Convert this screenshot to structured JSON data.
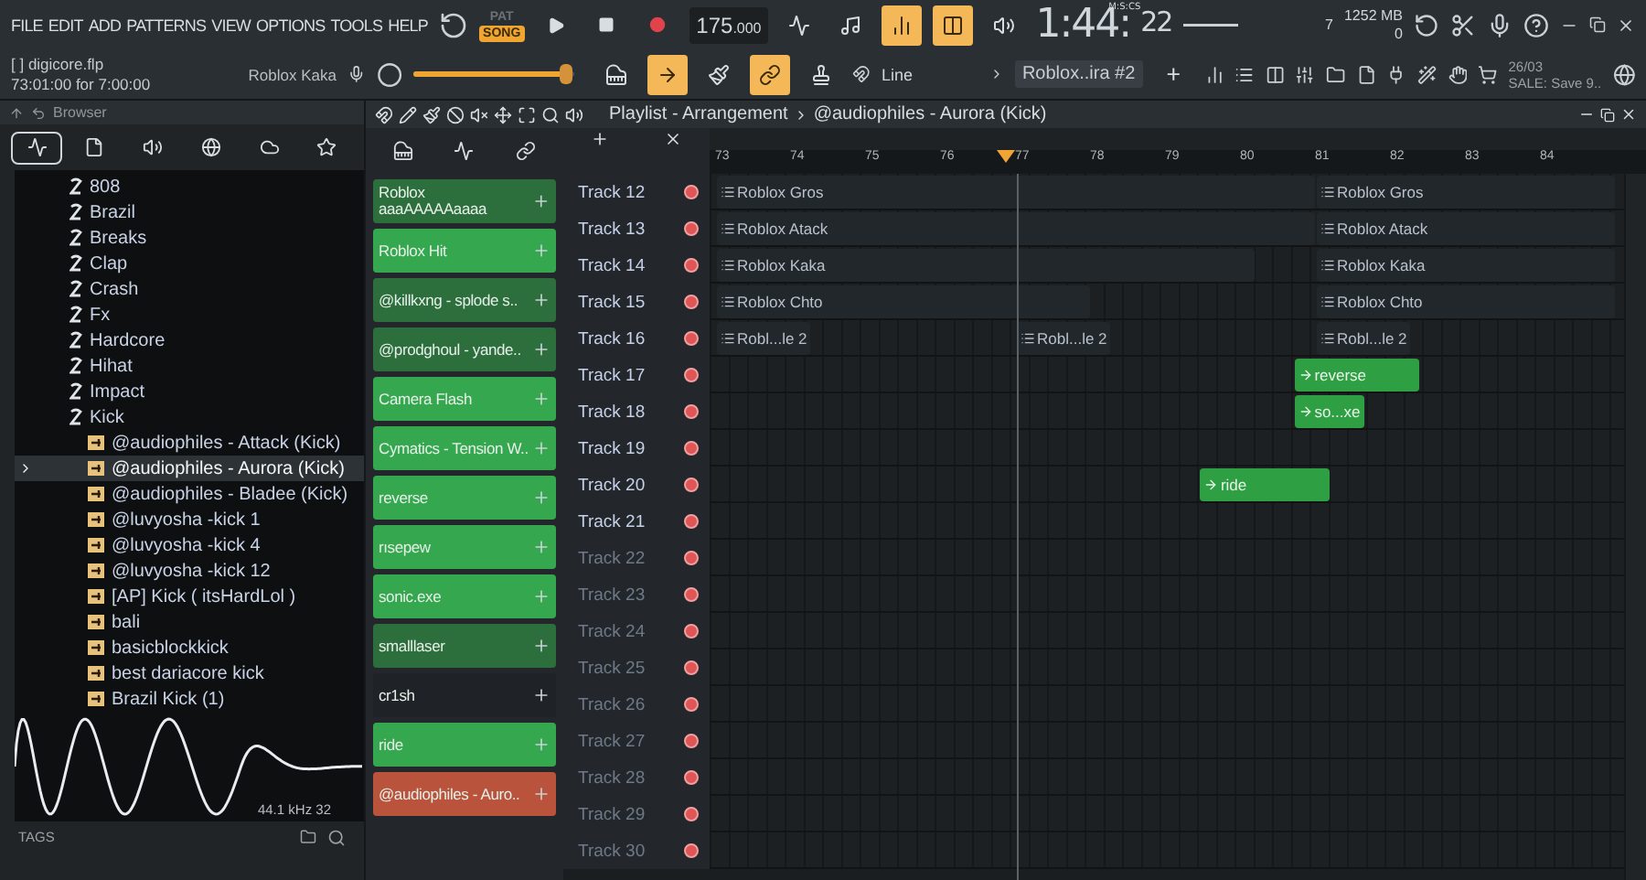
{
  "menu": [
    "FILE",
    "EDIT",
    "ADD",
    "PATTERNS",
    "VIEW",
    "OPTIONS",
    "TOOLS",
    "HELP"
  ],
  "transport": {
    "modes": [
      {
        "label": "PAT",
        "selected": false
      },
      {
        "label": "SONG",
        "selected": true
      }
    ],
    "tempo": "175",
    "tempo_decimals": ".000",
    "time": "1:44:",
    "time_cs": "22",
    "time_format": "M:S:CS"
  },
  "toolbar_toggles": [
    {
      "on": false
    },
    {
      "on": false
    },
    {
      "on": true
    },
    {
      "on": true
    },
    {
      "on": false
    }
  ],
  "tool_toggles": [
    {
      "on": false
    },
    {
      "on": true
    },
    {
      "on": false
    },
    {
      "on": true
    },
    {
      "on": false
    }
  ],
  "monitor": {
    "voices": "7",
    "memory": "1252 MB",
    "cpu": "0"
  },
  "project": {
    "file": "[ ] digicore.flp",
    "position": "73:01:00 for 7:00:00",
    "hint": "Roblox Kaka",
    "master": {
      "level": 0.95
    }
  },
  "snap": "Line",
  "pattern": "Roblox..ira #2",
  "pattern_add": "+",
  "news": {
    "date": "26/03",
    "text": "SALE: Save 9.."
  },
  "browser": {
    "title": "Browser",
    "tabs": [
      {
        "selected": true
      },
      {
        "selected": false
      },
      {
        "selected": false
      },
      {
        "selected": false
      },
      {
        "selected": false
      },
      {
        "selected": false
      }
    ],
    "tree": [
      {
        "name": "808",
        "kind": "folder",
        "selected": false
      },
      {
        "name": "Brazil",
        "kind": "folder",
        "selected": false
      },
      {
        "name": "Breaks",
        "kind": "folder",
        "selected": false
      },
      {
        "name": "Clap",
        "kind": "folder",
        "selected": false
      },
      {
        "name": "Crash",
        "kind": "folder",
        "selected": false
      },
      {
        "name": "Fx",
        "kind": "folder",
        "selected": false
      },
      {
        "name": "Hardcore",
        "kind": "folder",
        "selected": false
      },
      {
        "name": "Hihat",
        "kind": "folder",
        "selected": false
      },
      {
        "name": "Impact",
        "kind": "folder",
        "selected": false
      },
      {
        "name": "Kick",
        "kind": "folder",
        "selected": false,
        "children": [
          {
            "name": "@audiophiles - Attack (Kick)",
            "kind": "file",
            "selected": false
          },
          {
            "name": "@audiophiles - Aurora (Kick)",
            "kind": "file",
            "selected": true
          },
          {
            "name": "@audiophiles - Bladee (Kick)",
            "kind": "file",
            "selected": false
          },
          {
            "name": "@luvyosha -kick 1",
            "kind": "file",
            "selected": false
          },
          {
            "name": "@luvyosha -kick 4",
            "kind": "file",
            "selected": false
          },
          {
            "name": "@luvyosha -kick 12",
            "kind": "file",
            "selected": false
          },
          {
            "name": "[AP] Kick ( itsHardLol )",
            "kind": "file",
            "selected": false
          },
          {
            "name": "bali",
            "kind": "file",
            "selected": false
          },
          {
            "name": "basicblockkick",
            "kind": "file",
            "selected": false
          },
          {
            "name": "best dariacore kick",
            "kind": "file",
            "selected": false
          },
          {
            "name": "Brazil Kick (1)",
            "kind": "file",
            "selected": false
          }
        ]
      }
    ],
    "preview_info": "44.1 kHz 32",
    "tags": "TAGS"
  },
  "playlist": {
    "title": "Playlist - Arrangement",
    "pattern": "@audiophiles - Aurora (Kick)",
    "ruler": [
      "73",
      "74",
      "75",
      "76",
      "77",
      "78",
      "79",
      "80",
      "81",
      "82",
      "83",
      "84"
    ],
    "tracks": [
      {
        "name": "Track 12",
        "active": true,
        "clips": [
          {
            "label": "Roblox Gros",
            "kind": "pattern"
          },
          {
            "label": "Roblox Gros",
            "kind": "pattern"
          }
        ]
      },
      {
        "name": "Track 13",
        "active": true,
        "clips": [
          {
            "label": "Roblox Atack",
            "kind": "pattern"
          },
          {
            "label": "Roblox Atack",
            "kind": "pattern"
          }
        ]
      },
      {
        "name": "Track 14",
        "active": true,
        "clips": [
          {
            "label": "Roblox Kaka",
            "kind": "pattern"
          },
          {
            "label": "Roblox Kaka",
            "kind": "pattern"
          }
        ]
      },
      {
        "name": "Track 15",
        "active": true,
        "clips": [
          {
            "label": "Roblox Chto",
            "kind": "pattern"
          },
          {
            "label": "Roblox Chto",
            "kind": "pattern"
          }
        ]
      },
      {
        "name": "Track 16",
        "active": true,
        "clips": [
          {
            "label": "Robl...le 2",
            "kind": "pattern"
          },
          {
            "label": "Robl...le 2",
            "kind": "pattern"
          },
          {
            "label": "Robl...le 2",
            "kind": "pattern"
          }
        ]
      },
      {
        "name": "Track 17",
        "active": true,
        "clips": [
          {
            "label": "reverse",
            "kind": "audio"
          }
        ]
      },
      {
        "name": "Track 18",
        "active": true,
        "clips": [
          {
            "label": "so...xe",
            "kind": "audio"
          }
        ]
      },
      {
        "name": "Track 19",
        "active": true
      },
      {
        "name": "Track 20",
        "active": true,
        "clips": [
          {
            "label": "ride",
            "kind": "audio"
          }
        ]
      },
      {
        "name": "Track 21",
        "active": true
      },
      {
        "name": "Track 22",
        "active": false
      },
      {
        "name": "Track 23",
        "active": false
      },
      {
        "name": "Track 24",
        "active": false
      },
      {
        "name": "Track 25",
        "active": false
      },
      {
        "name": "Track 26",
        "active": false
      },
      {
        "name": "Track 27",
        "active": false
      },
      {
        "name": "Track 28",
        "active": false
      },
      {
        "name": "Track 29",
        "active": false
      },
      {
        "name": "Track 30",
        "active": false
      }
    ]
  },
  "channels": [
    {
      "name": "Roblox aaaAAAAAaaaa",
      "color": "#2c6e3c"
    },
    {
      "name": "Roblox Hit",
      "color": "#35a84f"
    },
    {
      "name": "@killkxng - splode s..",
      "color": "#2c6e3c"
    },
    {
      "name": "@prodghoul - yande..",
      "color": "#2c6e3c"
    },
    {
      "name": "Camera Flash",
      "color": "#35a84f"
    },
    {
      "name": "Cymatics - Tension W..",
      "color": "#35a84f"
    },
    {
      "name": "reverse",
      "color": "#35a84f"
    },
    {
      "name": "rısepew",
      "color": "#35a84f"
    },
    {
      "name": "sonic.exe",
      "color": "#35a84f"
    },
    {
      "name": "smalllaser",
      "color": "#2c6e3c"
    },
    {
      "name": "cr1sh",
      "color": "#1f2327"
    },
    {
      "name": "ride",
      "color": "#35a84f"
    },
    {
      "name": "@audiophiles - Auro..",
      "color": "#b9533c"
    }
  ]
}
